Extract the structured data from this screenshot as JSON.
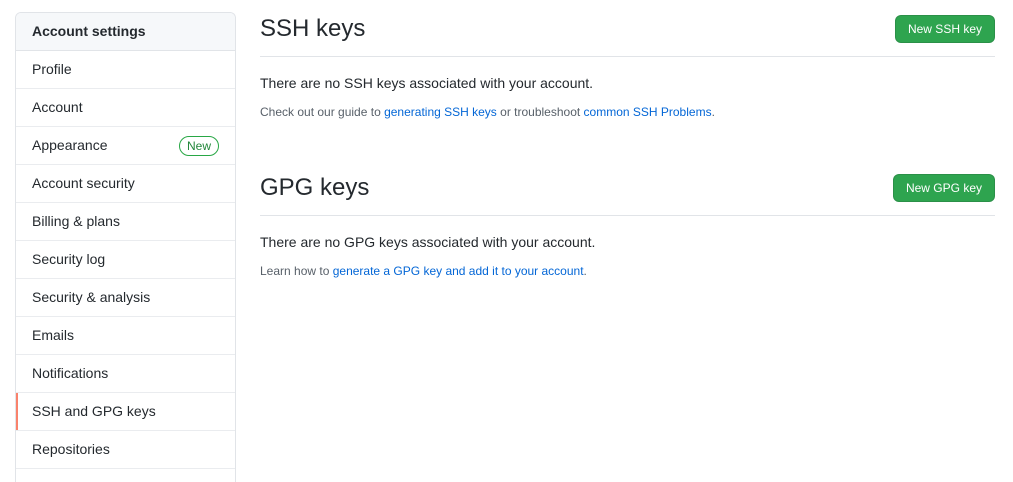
{
  "sidebar": {
    "header": "Account settings",
    "items": [
      {
        "label": "Profile"
      },
      {
        "label": "Account"
      },
      {
        "label": "Appearance",
        "badge": "New"
      },
      {
        "label": "Account security"
      },
      {
        "label": "Billing & plans"
      },
      {
        "label": "Security log"
      },
      {
        "label": "Security & analysis"
      },
      {
        "label": "Emails"
      },
      {
        "label": "Notifications"
      },
      {
        "label": "SSH and GPG keys",
        "selected": true
      },
      {
        "label": "Repositories"
      }
    ]
  },
  "ssh": {
    "title": "SSH keys",
    "button": "New SSH key",
    "empty_message": "There are no SSH keys associated with your account.",
    "note_prefix": "Check out our guide to ",
    "link_generating": "generating SSH keys",
    "note_middle": " or troubleshoot ",
    "link_problems": "common SSH Problems",
    "note_suffix": "."
  },
  "gpg": {
    "title": "GPG keys",
    "button": "New GPG key",
    "empty_message": "There are no GPG keys associated with your account.",
    "note_prefix": "Learn how to ",
    "link_generate": "generate a GPG key and add it to your account",
    "note_suffix": "."
  },
  "colors": {
    "accent_selected": "#f9826c",
    "button_green": "#2ea44f",
    "link_blue": "#0366d6",
    "badge_green": "#28a745"
  }
}
